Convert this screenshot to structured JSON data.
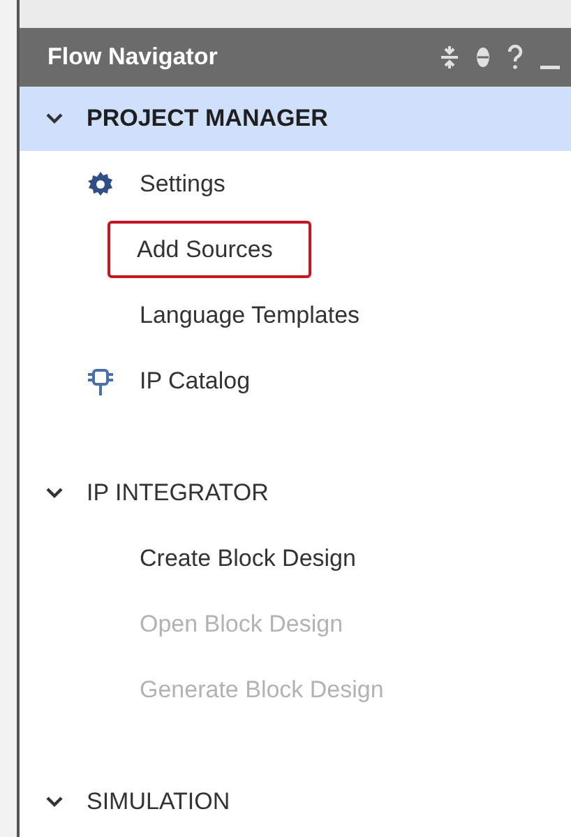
{
  "panel": {
    "title": "Flow Navigator"
  },
  "sections": [
    {
      "title": "PROJECT MANAGER",
      "expanded": true,
      "selected": true,
      "items": [
        {
          "label": "Settings",
          "kind": "gear",
          "disabled": false,
          "outlined": false
        },
        {
          "label": "Add Sources",
          "kind": "plain",
          "disabled": false,
          "outlined": true
        },
        {
          "label": "Language Templates",
          "kind": "plain",
          "disabled": false,
          "outlined": false
        },
        {
          "label": "IP Catalog",
          "kind": "chip",
          "disabled": false,
          "outlined": false
        }
      ]
    },
    {
      "title": "IP INTEGRATOR",
      "expanded": true,
      "selected": false,
      "items": [
        {
          "label": "Create Block Design",
          "kind": "indent",
          "disabled": false,
          "outlined": false
        },
        {
          "label": "Open Block Design",
          "kind": "indent",
          "disabled": true,
          "outlined": false
        },
        {
          "label": "Generate Block Design",
          "kind": "indent",
          "disabled": true,
          "outlined": false
        }
      ]
    },
    {
      "title": "SIMULATION",
      "expanded": true,
      "selected": false
    }
  ]
}
